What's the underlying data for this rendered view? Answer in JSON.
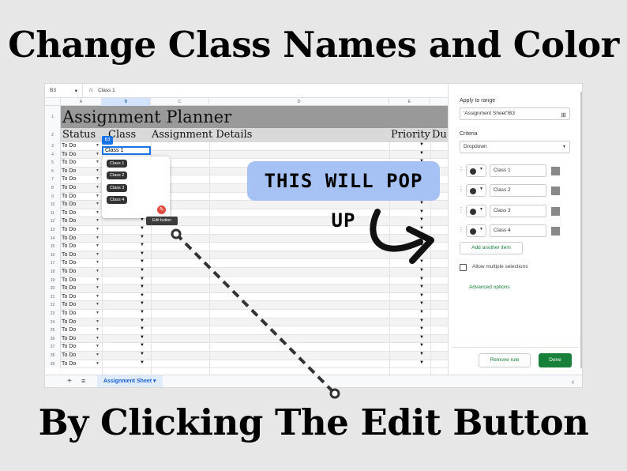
{
  "headline_top": "Change Class Names and Color",
  "headline_bottom": "By Clicking The Edit Button",
  "formula_bar": {
    "cell_ref": "B3",
    "fx": "fx",
    "value": "Class 1"
  },
  "columns": [
    "A",
    "B",
    "C",
    "D",
    "E"
  ],
  "sheet": {
    "title": "Assignment Planner",
    "headers": {
      "status": "Status",
      "class": "Class",
      "details": "Assignment Details",
      "priority": "Priority",
      "due": "Du"
    },
    "rows": [
      {
        "n": "3",
        "status": "To Do"
      },
      {
        "n": "4",
        "status": "To Do"
      },
      {
        "n": "5",
        "status": "To Do"
      },
      {
        "n": "6",
        "status": "To Do"
      },
      {
        "n": "7",
        "status": "To Do"
      },
      {
        "n": "8",
        "status": "To Do"
      },
      {
        "n": "9",
        "status": "To Do"
      },
      {
        "n": "10",
        "status": "To Do"
      },
      {
        "n": "11",
        "status": "To Do"
      },
      {
        "n": "12",
        "status": "To Do"
      },
      {
        "n": "13",
        "status": "To Do"
      },
      {
        "n": "14",
        "status": "To Do"
      },
      {
        "n": "15",
        "status": "To Do"
      },
      {
        "n": "16",
        "status": "To Do"
      },
      {
        "n": "17",
        "status": "To Do"
      },
      {
        "n": "18",
        "status": "To Do"
      },
      {
        "n": "19",
        "status": "To Do"
      },
      {
        "n": "20",
        "status": "To Do"
      },
      {
        "n": "21",
        "status": "To Do"
      },
      {
        "n": "22",
        "status": "To Do"
      },
      {
        "n": "23",
        "status": "To Do"
      },
      {
        "n": "24",
        "status": "To Do"
      },
      {
        "n": "25",
        "status": "To Do"
      },
      {
        "n": "26",
        "status": "To Do"
      },
      {
        "n": "27",
        "status": "To Do"
      },
      {
        "n": "28",
        "status": "To Do"
      },
      {
        "n": "29",
        "status": "To Do"
      }
    ]
  },
  "selected_cell": {
    "tag": "B3",
    "value": "Class 1"
  },
  "dropdown_options": [
    "Class 1",
    "Class 2",
    "Class 3",
    "Class 4"
  ],
  "edit_tooltip": "Edit button",
  "sheet_tab": "Assignment Sheet",
  "panel": {
    "apply_label": "Apply to range",
    "range_value": "'Assignment Sheet'!B3",
    "criteria_label": "Criteria",
    "criteria_value": "Dropdown",
    "items": [
      "Class 1",
      "Class 2",
      "Class 3",
      "Class 4"
    ],
    "add_item": "Add another item",
    "allow_multiple": "Allow multiple selections",
    "advanced": "Advanced options",
    "remove_rule": "Remove rule",
    "done": "Done"
  },
  "callout": "THIS WILL POP UP",
  "colors": {
    "accent": "#1a73e8",
    "green": "#188038",
    "callout": "#a6c2f5",
    "title_bg": "#999999"
  }
}
